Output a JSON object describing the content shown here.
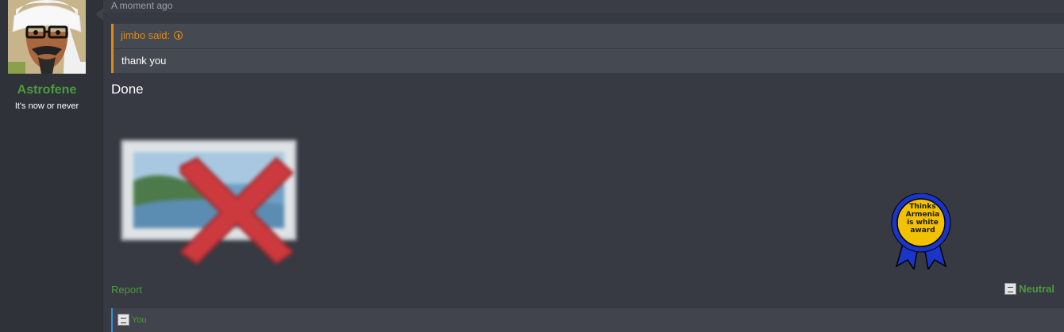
{
  "post": {
    "timestamp": "A moment ago",
    "message": "Done"
  },
  "user": {
    "username": "Astrofene",
    "user_title": "It's now or never"
  },
  "quote": {
    "author_line": "jimbo said:",
    "text": "thank you"
  },
  "award": {
    "line1": "Thinks",
    "line2": "Armenia",
    "line3": "is white",
    "line4": "award",
    "ribbon_color": "#1a35c8",
    "badge_color": "#f2c200"
  },
  "actions": {
    "report_label": "Report",
    "rating_label": "Neutral"
  },
  "reactions_bar": {
    "reactor_label": "You"
  },
  "colors": {
    "accent_green": "#4b9b3c",
    "quote_orange": "#e08a16",
    "reactions_border": "#3a8fd6"
  }
}
